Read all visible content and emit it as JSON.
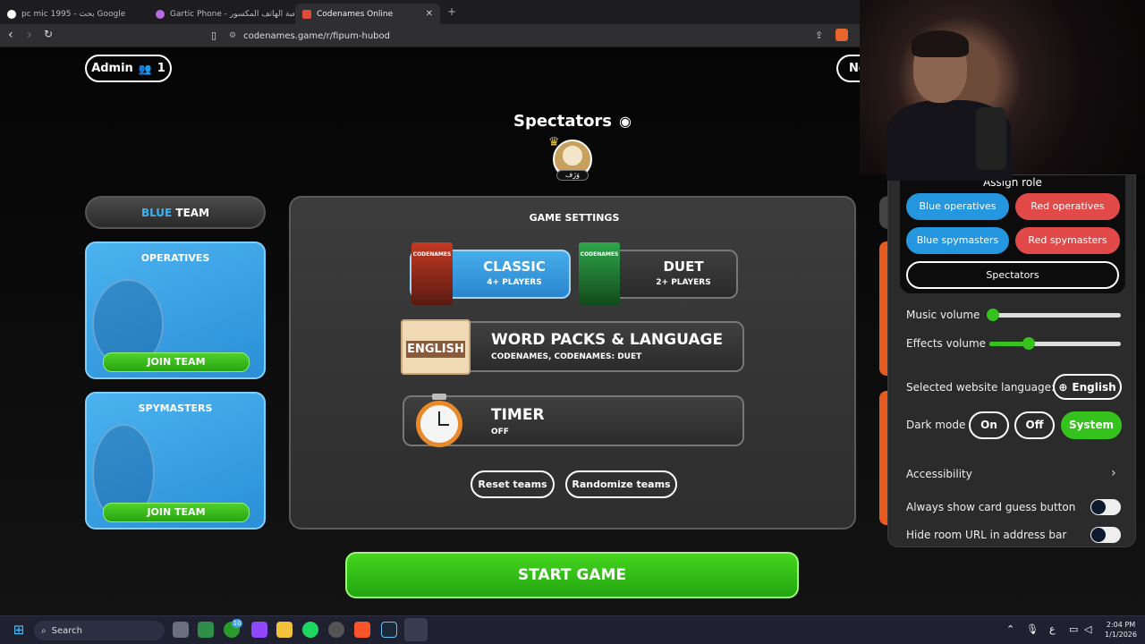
{
  "browser": {
    "tabs": [
      {
        "label": "pc mic 1995 - بحث Google"
      },
      {
        "label": "Gartic Phone - لعبة الهاتف المكسور"
      },
      {
        "label": "Codenames Online"
      }
    ],
    "url": "codenames.game/r/fipum-hubod"
  },
  "header": {
    "admin_label": "Admin",
    "player_count": "1",
    "next_label": "Ne"
  },
  "spectators": {
    "title": "Spectators",
    "player_name": "وَزَف"
  },
  "blue_team": {
    "title_prefix": "BLUE",
    "title_suffix": " TEAM",
    "operatives_label": "OPERATIVES",
    "spymasters_label": "SPYMASTERS",
    "join_label": "JOIN TEAM"
  },
  "settings": {
    "title": "GAME SETTINGS",
    "modes": [
      {
        "name": "CLASSIC",
        "sub": "4+ PLAYERS",
        "art": "CODENAMES"
      },
      {
        "name": "DUET",
        "sub": "2+ PLAYERS",
        "art": "CODENAMES"
      }
    ],
    "wordpacks": {
      "title": "WORD PACKS & LANGUAGE",
      "sub": "CODENAMES, CODENAMES: DUET",
      "badge": "ENGLISH"
    },
    "timer": {
      "title": "TIMER",
      "sub": "OFF"
    },
    "reset_label": "Reset teams",
    "randomize_label": "Randomize teams"
  },
  "start_label": "START GAME",
  "menu": {
    "assign_title": "Assign role",
    "roles": {
      "blue_operatives": "Blue operatives",
      "red_operatives": "Red operatives",
      "blue_spymasters": "Blue spymasters",
      "red_spymasters": "Red spymasters",
      "spectators": "Spectators"
    },
    "music_volume_label": "Music volume",
    "music_volume": 0.0,
    "effects_volume_label": "Effects volume",
    "effects_volume": 0.3,
    "language_label": "Selected website language:",
    "language_value": "English",
    "dark_mode_label": "Dark mode",
    "dark_mode_options": [
      "On",
      "Off",
      "System"
    ],
    "dark_mode_selected": "System",
    "accessibility_label": "Accessibility",
    "card_guess_label": "Always show card guess button",
    "hide_url_label": "Hide room URL in address bar"
  },
  "taskbar": {
    "search_label": "Search",
    "xbox_badge": "10",
    "lang": "ع",
    "time": "2:04 PM",
    "date": "1/1/2026"
  },
  "colors": {
    "blue": "#2a8fd6",
    "red": "#e24a4a",
    "green": "#35c21c"
  }
}
